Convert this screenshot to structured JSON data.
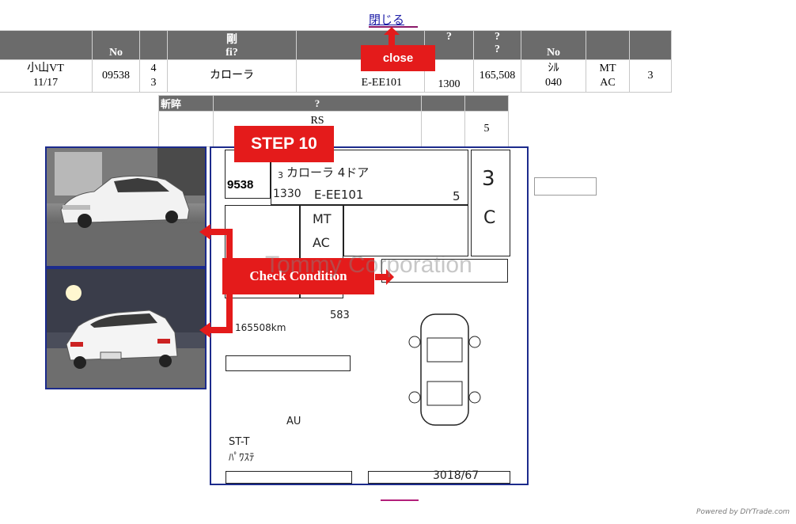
{
  "close_link": "閉じる",
  "close_label": "close",
  "step_label": "STEP 10",
  "check_label": "Check Condition",
  "watermark": "Tommy Corporation",
  "footer": "Powered by DIYTrade.com",
  "main_table": {
    "headers": [
      "",
      "No",
      "",
      "剛\nfi?",
      "",
      "?",
      "?\n?",
      "No",
      "",
      ""
    ],
    "row": [
      "小山VT\n11/17",
      "09538",
      "4\n3",
      "カローラ",
      "4\nE-EE101",
      "1300",
      "165,508",
      "ｼﾙ\n040",
      "MT\nAC",
      "3"
    ]
  },
  "sub_table": {
    "headers": [
      "斬睟",
      "?",
      "",
      ""
    ],
    "row": [
      "",
      "RS",
      "",
      "5"
    ]
  },
  "sheet": {
    "lot_no": "9538",
    "model_hw": "カローラ 4ドア",
    "displacement_hw": "1330",
    "type_hw": "E-EE101",
    "seats_hw": "5",
    "grade_hw": "3",
    "interior_hw": "C",
    "trans_hw": "MT",
    "ac_hw": "AC",
    "km_hw": "165508km",
    "month_hw": "3",
    "note_hw": "ST-T",
    "note2_hw": "ﾊﾟﾜｽﾃ",
    "stock_hw": "3018/67",
    "aa_hw": "AU",
    "distance_hw": "583"
  }
}
